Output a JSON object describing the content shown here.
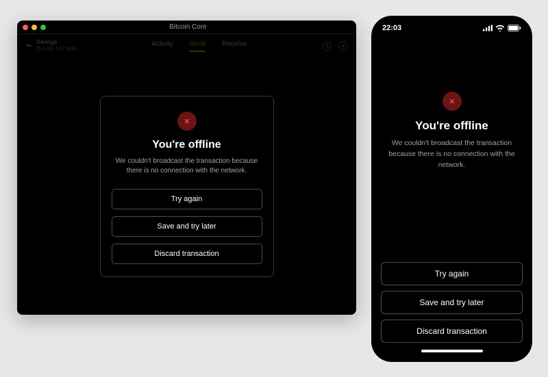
{
  "desktop": {
    "window_title": "Bitcoin Core",
    "account": {
      "name": "Savings",
      "balance": "₿ 5.00 167 938"
    },
    "nav": {
      "items": [
        "Activity",
        "Send",
        "Receive"
      ],
      "active_index": 1
    },
    "modal": {
      "title": "You're offline",
      "message": "We couldn't broadcast the transaction because there is no connection with the network.",
      "buttons": [
        "Try again",
        "Save and try later",
        "Discard transaction"
      ]
    }
  },
  "phone": {
    "status": {
      "time": "22:03"
    },
    "title": "You're offline",
    "message": "We couldn't broadcast the transaction because there is no connection with the network.",
    "buttons": [
      "Try again",
      "Save and try later",
      "Discard transaction"
    ]
  },
  "colors": {
    "error_bg": "#6b1414",
    "error_x": "#ff4d4d",
    "accent": "#f6a623"
  }
}
